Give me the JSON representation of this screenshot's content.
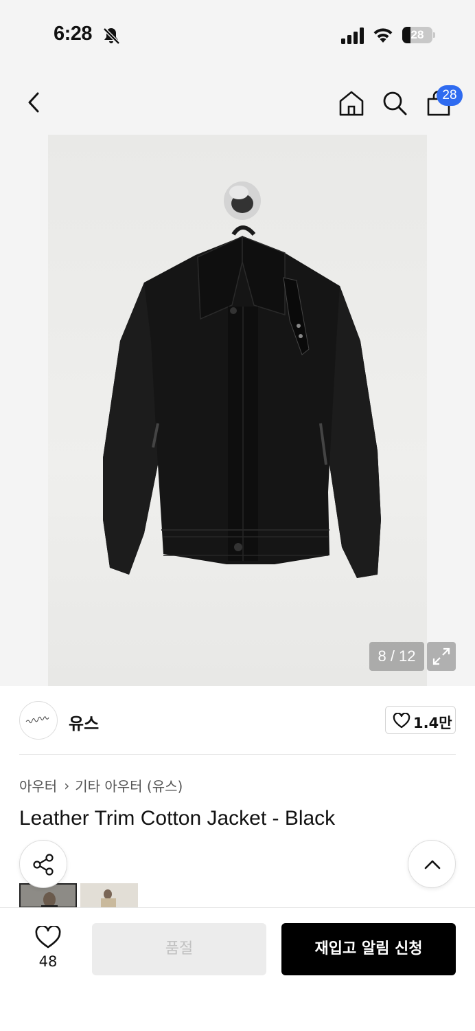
{
  "status_bar": {
    "time": "6:28",
    "battery_level": "28",
    "battery_fraction": 0.28,
    "icons": [
      "bell-slash-icon",
      "cellular-signal-icon",
      "wifi-icon",
      "battery-icon"
    ]
  },
  "header": {
    "icons": [
      "back-arrow-icon",
      "home-icon",
      "search-icon",
      "shopping-bag-icon"
    ],
    "cart_count": "28",
    "badge_color": "#2f6bf0"
  },
  "gallery": {
    "counter": "8 / 12"
  },
  "brand": {
    "name": "유스",
    "likes": "1.4만"
  },
  "breadcrumb": {
    "category": "아우터",
    "separator": "›",
    "subcategory": "기타 아우터 (유스)"
  },
  "product": {
    "title": "Leather Trim Cotton Jacket - Black"
  },
  "bottom_bar": {
    "wish_count": "48",
    "sold_out_label": "품절",
    "restock_label": "재입고 알림 신청",
    "accent_color": "#000000"
  }
}
